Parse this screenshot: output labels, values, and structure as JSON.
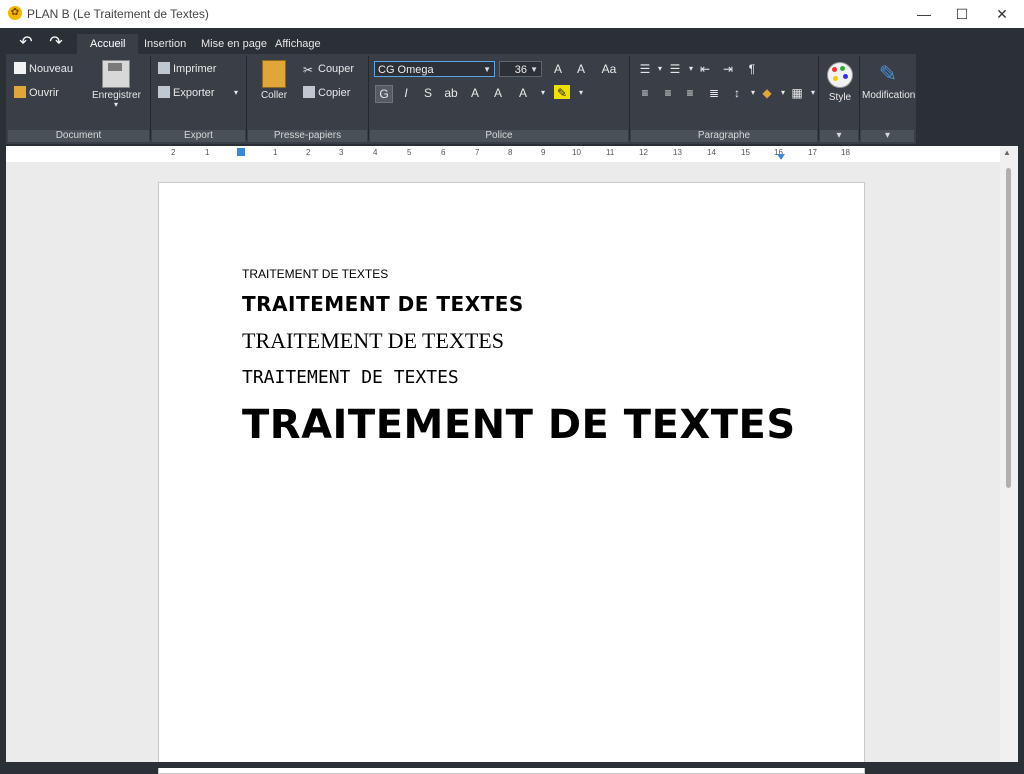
{
  "window": {
    "title": "PLAN B (Le Traitement de Textes)"
  },
  "window_controls": {
    "minimize": "—",
    "maximize": "☐",
    "close": "✕"
  },
  "quick_access": {
    "undo": "↶",
    "redo": "↷"
  },
  "tabs": [
    {
      "label": "Accueil"
    },
    {
      "label": "Insertion"
    },
    {
      "label": "Mise en page"
    },
    {
      "label": "Affichage"
    }
  ],
  "groups": {
    "document": "Document",
    "export": "Export",
    "clipboard": "Presse-papiers",
    "font": "Police",
    "paragraph": "Paragraphe"
  },
  "document_group": {
    "new": "Nouveau",
    "open": "Ouvrir",
    "save": "Enregistrer"
  },
  "export_group": {
    "print": "Imprimer",
    "export": "Exporter"
  },
  "clipboard_group": {
    "paste": "Coller",
    "cut": "Couper",
    "copy": "Copier"
  },
  "font_group": {
    "font_name": "CG Omega",
    "font_size": "36"
  },
  "style_group": {
    "style": "Style",
    "modification": "Modification"
  },
  "ruler": {
    "ticks": [
      "2",
      "1",
      "1",
      "2",
      "3",
      "4",
      "5",
      "6",
      "7",
      "8",
      "9",
      "10",
      "11",
      "12",
      "13",
      "14",
      "15",
      "16",
      "17",
      "18"
    ]
  },
  "document": {
    "lines": [
      "TRAITEMENT DE TEXTES",
      "TRAITEMENT DE TEXTES",
      "TRAITEMENT DE TEXTES",
      "TRAITEMENT DE TEXTES",
      "TRAITEMENT DE TEXTES"
    ]
  },
  "colors": {
    "ribbon_bg": "#2b2f36",
    "ribbon_body": "#3a3f47",
    "accent": "#58a6e8"
  }
}
